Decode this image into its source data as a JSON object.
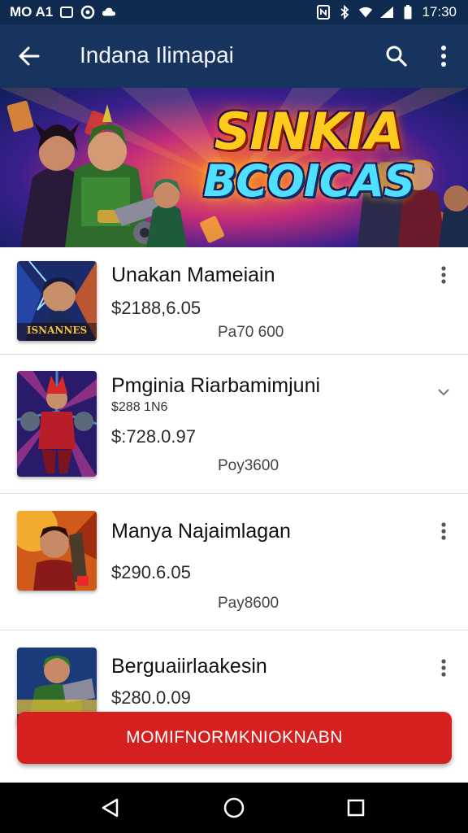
{
  "status_bar": {
    "left_text": "MO A1",
    "time": "17:30",
    "icons": [
      "notification-box-icon",
      "data-saver-icon",
      "cloud-icon",
      "nfc-icon",
      "bluetooth-icon",
      "wifi-icon",
      "signal-icon",
      "battery-icon"
    ]
  },
  "app_bar": {
    "title": "Indana Ilimapai",
    "icons": [
      "back-arrow-icon",
      "search-icon",
      "more-vert-icon"
    ]
  },
  "banner": {
    "title_line1": "SINKIA",
    "title_line2": "BCOICAS"
  },
  "items": [
    {
      "name": "Unakan Mameiain",
      "price": "$2188,6.05",
      "pay": "Pa70 600",
      "thumb_caption": "ISNANNES",
      "menu_icon": "more-vert-icon"
    },
    {
      "name": "Pmginia Riarbamimjuni",
      "sub": "$288 1N6",
      "price": "$:728.0.97",
      "pay": "Poy3600",
      "menu_icon": "chevron-down-icon"
    },
    {
      "name": "Manya Najaimlagan",
      "price": "$290.6.05",
      "pay": "Pay8600",
      "menu_icon": "more-vert-icon"
    },
    {
      "name": "Berguaiirlaakesin",
      "price": "$280.0.09",
      "menu_icon": "more-vert-icon"
    }
  ],
  "cta": {
    "label": "MOMIFNORMKNIOKNABN"
  },
  "nav_bar": {
    "icons": [
      "back-triangle-icon",
      "home-circle-icon",
      "recents-square-icon"
    ]
  },
  "colors": {
    "status_bar": "#0f2a4f",
    "app_bar": "#17345e",
    "cta": "#d61f1f",
    "nav_bar": "#000000"
  }
}
